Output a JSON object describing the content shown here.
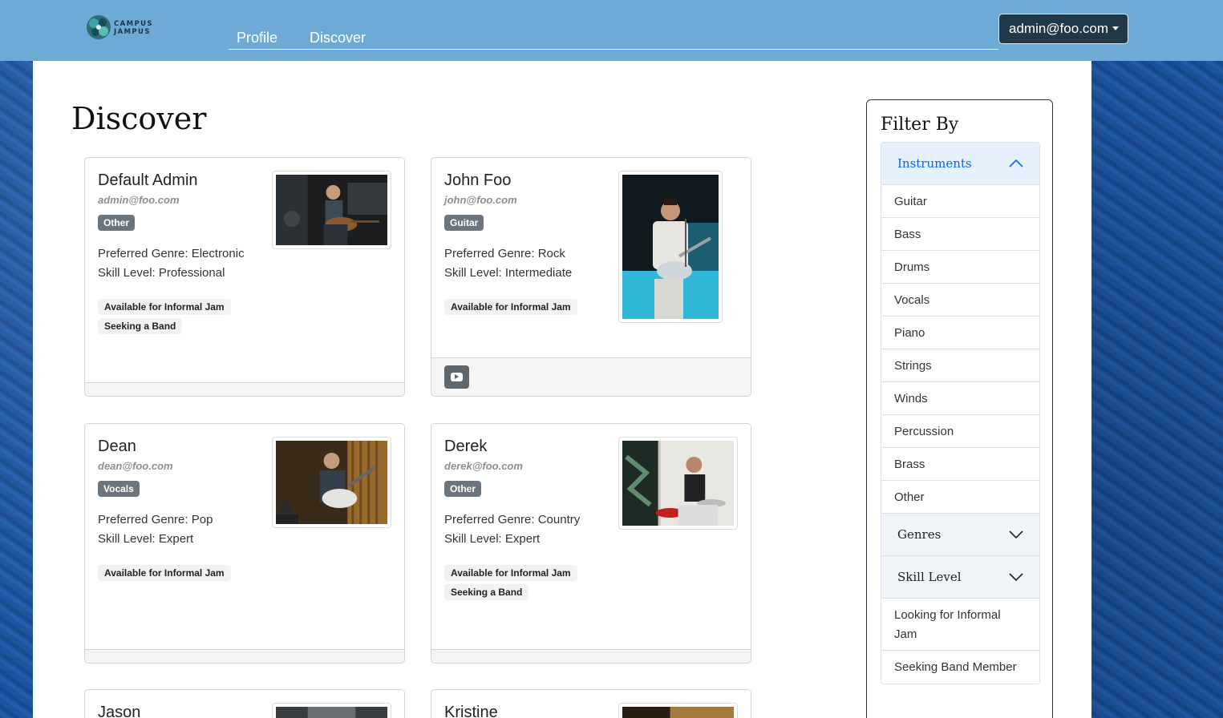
{
  "navbar": {
    "logo_line1": "CAMPUS",
    "logo_line2": "JAMPUS",
    "links": [
      "Profile",
      "Discover"
    ],
    "user_label": "admin@foo.com"
  },
  "page": {
    "title": "Discover"
  },
  "cards": [
    {
      "name": "Default Admin",
      "email": "admin@foo.com",
      "instrument": "Other",
      "genre": "Preferred Genre: Electronic",
      "skill": "Skill Level: Professional",
      "tags": [
        "Available for Informal Jam",
        "Seeking a Band"
      ],
      "photo": "guitarist-studio-photo",
      "has_youtube": false
    },
    {
      "name": "John Foo",
      "email": "john@foo.com",
      "instrument": "Guitar",
      "genre": "Preferred Genre: Rock",
      "skill": "Skill Level: Intermediate",
      "tags": [
        "Available for Informal Jam"
      ],
      "photo": "guitarist-stage-photo",
      "has_youtube": true
    },
    {
      "name": "Dean",
      "email": "dean@foo.com",
      "instrument": "Vocals",
      "genre": "Preferred Genre: Pop",
      "skill": "Skill Level: Expert",
      "tags": [
        "Available for Informal Jam"
      ],
      "photo": "singer-guitar-photo",
      "has_youtube": false
    },
    {
      "name": "Derek",
      "email": "derek@foo.com",
      "instrument": "Other",
      "genre": "Preferred Genre: Country",
      "skill": "Skill Level: Expert",
      "tags": [
        "Available for Informal Jam",
        "Seeking a Band"
      ],
      "photo": "drummer-photo",
      "has_youtube": false
    },
    {
      "name": "Jason"
    },
    {
      "name": "Kristine"
    }
  ],
  "filter": {
    "title": "Filter By",
    "instruments_header": "Instruments",
    "instruments": [
      "Guitar",
      "Bass",
      "Drums",
      "Vocals",
      "Piano",
      "Strings",
      "Winds",
      "Percussion",
      "Brass",
      "Other"
    ],
    "genres_header": "Genres",
    "skill_header": "Skill Level",
    "extras": [
      "Looking for Informal Jam",
      "Seeking Band Member"
    ]
  },
  "colors": {
    "navbar": "#6eaad6",
    "user_button": "#203847",
    "badge": "#6c757d",
    "accordion_open": "#e7f1fd",
    "accordion_open_text": "#0c63e4"
  }
}
